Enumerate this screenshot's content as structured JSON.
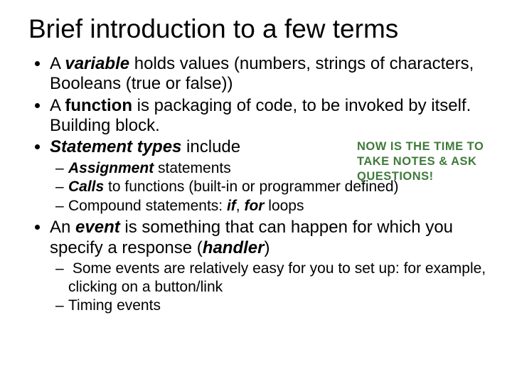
{
  "title": "Brief introduction to a few terms",
  "bullets": {
    "b1_a": "A ",
    "b1_b": "variable",
    "b1_c": " holds values (numbers, strings of characters, Booleans (true or false))",
    "b2_a": "A ",
    "b2_b": "function",
    "b2_c": " is packaging of code, to be invoked by itself. Building block.",
    "b3_a": " ",
    "b3_b": "Statement types",
    "b3_c": " include",
    "b3s1_a": "Assignment",
    "b3s1_b": " statements",
    "b3s2_a": "Calls",
    "b3s2_b": " to functions (built-in or programmer defined)",
    "b3s3_a": "Compound statements: ",
    "b3s3_b": "if",
    "b3s3_c": ", ",
    "b3s3_d": "for",
    "b3s3_e": " loops",
    "b4_a": "An ",
    "b4_b": "event",
    "b4_c": " is something that can happen for which you specify a response (",
    "b4_d": "handler",
    "b4_e": ")",
    "b4s1": " Some events are relatively easy for you to set up: for example, clicking on a button/link",
    "b4s2": "Timing events"
  },
  "callout": "NOW IS THE TIME TO TAKE NOTES & ASK QUESTIONS!"
}
